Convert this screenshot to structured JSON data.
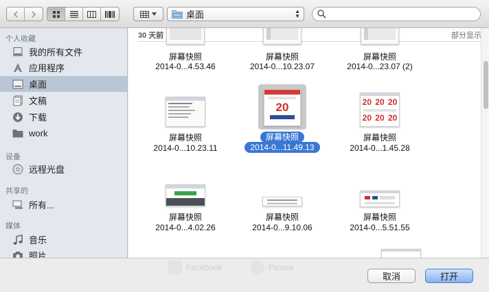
{
  "toolbar": {
    "back_icon": "chevron-left-icon",
    "forward_icon": "chevron-right-icon",
    "views": [
      "icon-view-icon",
      "list-view-icon",
      "column-view-icon",
      "coverflow-view-icon"
    ],
    "active_view": 0,
    "location": "桌面",
    "search_placeholder": ""
  },
  "sidebar": {
    "sections": [
      {
        "label": "个人收藏",
        "items": [
          {
            "label": "我的所有文件",
            "icon": "all-files-icon"
          },
          {
            "label": "应用程序",
            "icon": "applications-icon"
          },
          {
            "label": "桌面",
            "icon": "desktop-icon",
            "selected": true
          },
          {
            "label": "文稿",
            "icon": "documents-icon"
          },
          {
            "label": "下载",
            "icon": "downloads-icon"
          },
          {
            "label": "work",
            "icon": "folder-icon"
          }
        ]
      },
      {
        "label": "设备",
        "items": [
          {
            "label": "远程光盘",
            "icon": "disc-icon"
          }
        ]
      },
      {
        "label": "共享的",
        "items": [
          {
            "label": "所有...",
            "icon": "network-icon"
          }
        ]
      },
      {
        "label": "媒体",
        "items": [
          {
            "label": "音乐",
            "icon": "music-icon"
          },
          {
            "label": "照片",
            "icon": "camera-icon"
          }
        ]
      }
    ]
  },
  "group": {
    "title": "30 天前",
    "action": "部分显示"
  },
  "files": [
    {
      "name": "屏幕快照",
      "date": "2014-0...4.53.46"
    },
    {
      "name": "屏幕快照",
      "date": "2014-0...10.23.07"
    },
    {
      "name": "屏幕快照",
      "date": "2014-0...23.07 (2)"
    },
    {
      "name": "屏幕快照",
      "date": "2014-0...10.23.11"
    },
    {
      "name": "屏幕快照",
      "date": "2014-0...11.49.13",
      "selected": true,
      "thumb_text": "20"
    },
    {
      "name": "屏幕快照",
      "date": "2014-0...1.45.28",
      "thumb_text": "20"
    },
    {
      "name": "屏幕快照",
      "date": "2014-0...4.02.26"
    },
    {
      "name": "屏幕快照",
      "date": "2014-0...9.10.06"
    },
    {
      "name": "屏幕快照",
      "date": "2014-0...5.51.55"
    }
  ],
  "ghost": {
    "facebook": "Facebook",
    "picasa": "Picasa"
  },
  "footer": {
    "cancel": "取消",
    "open": "打开"
  },
  "colors": {
    "selection": "#3a76d4",
    "sidebar_bg": "#e3e8ee",
    "sidebar_selected": "#b9c6d6",
    "primary_button": "#86b2ee"
  }
}
